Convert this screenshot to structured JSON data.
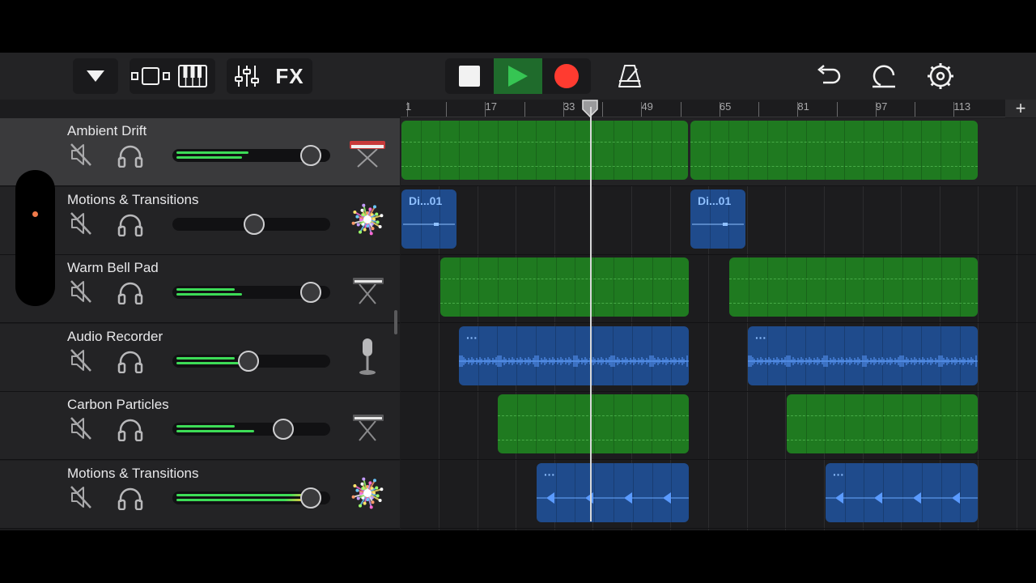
{
  "toolbar": {
    "fx_label": "FX"
  },
  "ruler": {
    "markers": [
      "1",
      "17",
      "33",
      "49",
      "65",
      "81",
      "97",
      "113"
    ],
    "add_label": "+"
  },
  "tracks": [
    {
      "name": "Ambient Drift",
      "volume": 0.88,
      "meter_a": 0.47,
      "meter_b": 0.43,
      "selected": true,
      "icon": "synth-keyboard-icon"
    },
    {
      "name": "Motions & Transitions",
      "volume": 0.51,
      "meter_a": 0,
      "meter_b": 0,
      "selected": false,
      "icon": "sparkle-burst-icon"
    },
    {
      "name": "Warm Bell Pad",
      "volume": 0.88,
      "meter_a": 0.38,
      "meter_b": 0.43,
      "selected": false,
      "icon": "keyboard-stand-icon"
    },
    {
      "name": "Audio Recorder",
      "volume": 0.47,
      "meter_a": 0.38,
      "meter_b": 0.43,
      "selected": false,
      "icon": "microphone-icon"
    },
    {
      "name": "Carbon Particles",
      "volume": 0.7,
      "meter_a": 0.38,
      "meter_b": 0.51,
      "selected": false,
      "icon": "keyboard-stand-icon"
    },
    {
      "name": "Motions & Transitions",
      "volume": 0.88,
      "meter_a": 0.87,
      "meter_b": 0.83,
      "selected": false,
      "icon": "sparkle-burst-icon"
    }
  ],
  "regions": {
    "drummer_label": "Di...01",
    "audio_label": "···"
  },
  "colors": {
    "midi_region": "#1f7a20",
    "audio_region": "#1f4b8c",
    "meter": "#3ddc57",
    "record": "#ff3b30",
    "play": "#36c553"
  }
}
